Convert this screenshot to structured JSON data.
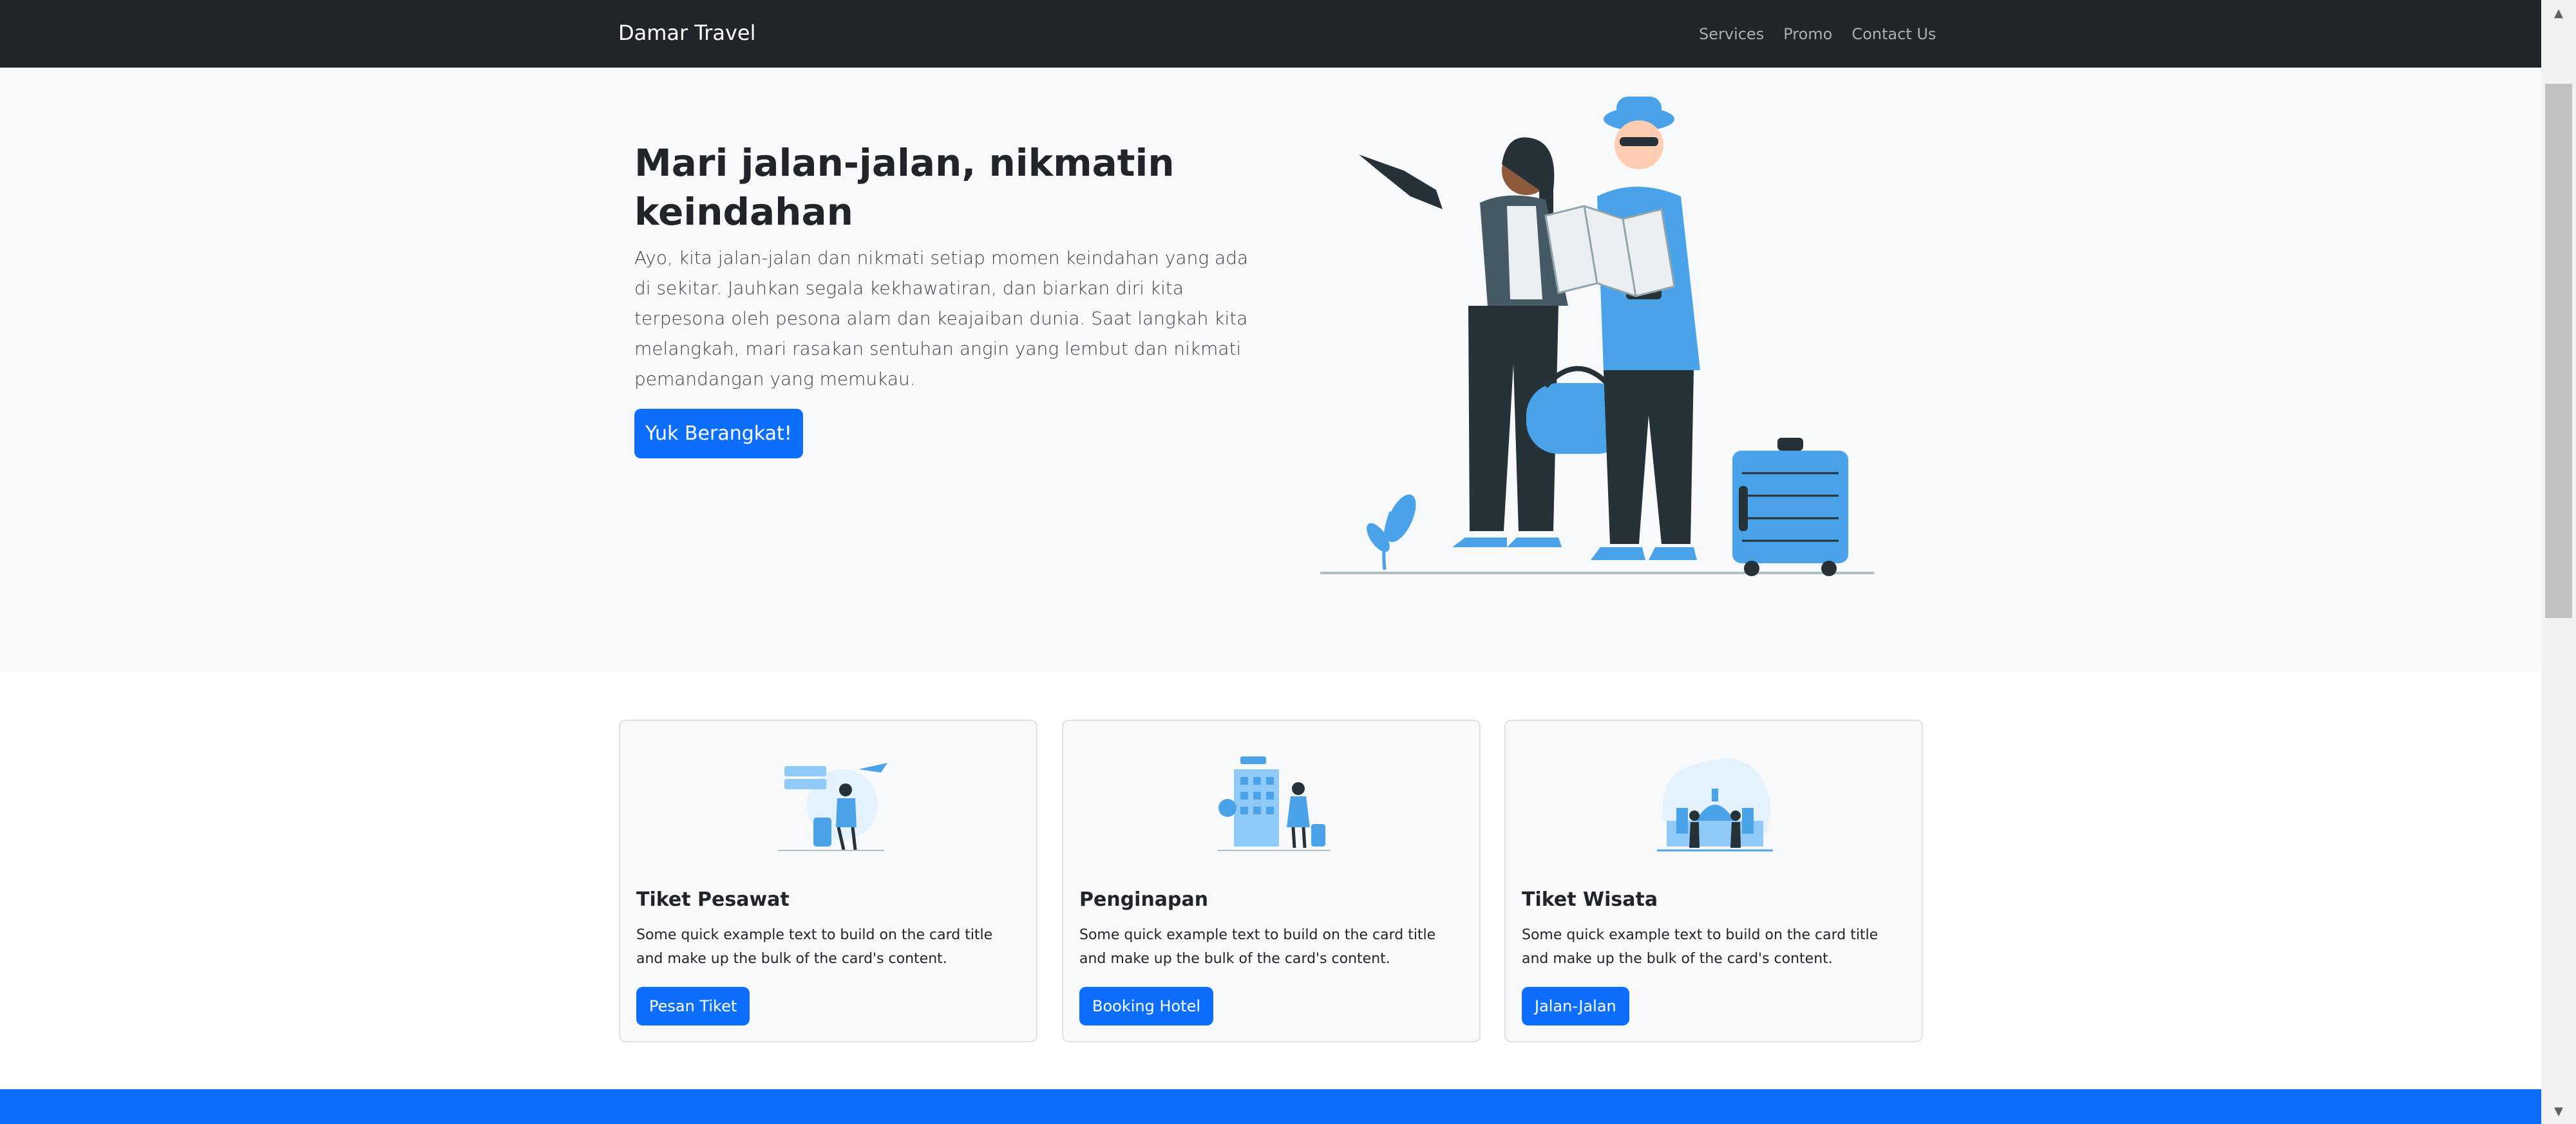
{
  "navbar": {
    "brand": "Damar Travel",
    "links": [
      "Services",
      "Promo",
      "Contact Us"
    ]
  },
  "hero": {
    "title": "Mari jalan-jalan, nikmatin keindahan",
    "text": "Ayo, kita jalan-jalan dan nikmati setiap momen keindahan yang ada di sekitar. Jauhkan segala kekhawatiran, dan biarkan diri kita terpesona oleh pesona alam dan keajaiban dunia. Saat langkah kita melangkah, mari rasakan sentuhan angin yang lembut dan nikmati pemandangan yang memukau.",
    "button_label": "Yuk Berangkat!",
    "illustration_icon": "travelers-illustration"
  },
  "cards": [
    {
      "title": "Tiket Pesawat",
      "text": "Some quick example text to build on the card title and make up the bulk of the card's content.",
      "button_label": "Pesan Tiket",
      "icon": "airport-illustration"
    },
    {
      "title": "Penginapan",
      "text": "Some quick example text to build on the card title and make up the bulk of the card's content.",
      "button_label": "Booking Hotel",
      "icon": "hotel-illustration"
    },
    {
      "title": "Tiket Wisata",
      "text": "Some quick example text to build on the card title and make up the bulk of the card's content.",
      "button_label": "Jalan-Jalan",
      "icon": "landmark-illustration"
    }
  ],
  "colors": {
    "navbar_bg": "#212529",
    "hero_bg": "#f8f9fa",
    "primary": "#0d6efd",
    "illustration_blue": "#4aa3e8",
    "illustration_dark": "#263238"
  }
}
